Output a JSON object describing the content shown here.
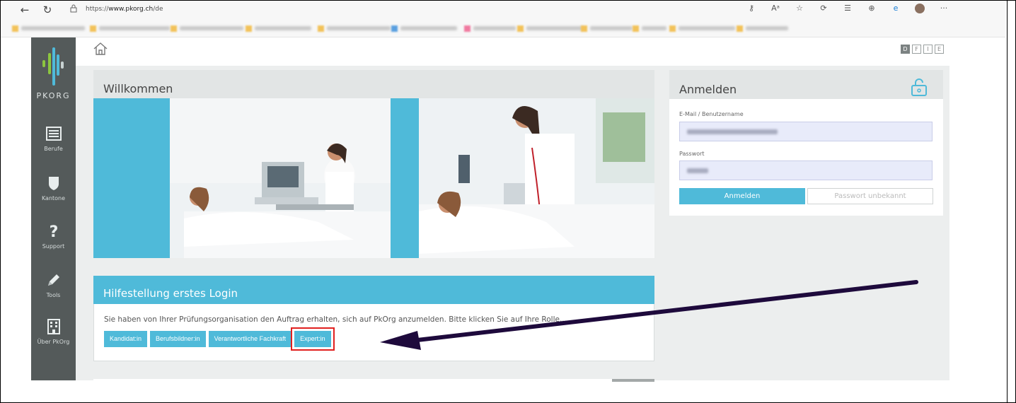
{
  "browser": {
    "url_prefix": "https://",
    "url_host": "www.pkorg.ch",
    "url_path": "/de"
  },
  "sidebar": {
    "logo_text": "PKORG",
    "items": [
      {
        "label": "Berufe",
        "icon": "list-icon"
      },
      {
        "label": "Kantone",
        "icon": "shield-icon"
      },
      {
        "label": "Support",
        "icon": "question-icon"
      },
      {
        "label": "Tools",
        "icon": "pencil-icon"
      },
      {
        "label": "Über PkOrg",
        "icon": "building-icon"
      }
    ]
  },
  "languages": [
    "D",
    "F",
    "I",
    "E"
  ],
  "welcome": {
    "title": "Willkommen"
  },
  "help": {
    "title": "Hilfestellung erstes Login",
    "text": "Sie haben von Ihrer Prüfungsorganisation den Auftrag erhalten, sich auf PkOrg anzumelden. Bitte klicken Sie auf Ihre Rolle...",
    "buttons": [
      "Kandidat:in",
      "Berufsbildner:in",
      "Verantwortliche Fachkraft",
      "Expert:in"
    ]
  },
  "login": {
    "title": "Anmelden",
    "username_label": "E-Mail / Benutzername",
    "password_label": "Passwort",
    "submit_label": "Anmelden",
    "forgot_label": "Passwort unbekannt"
  },
  "colors": {
    "accent": "#4fbad9",
    "sidebar": "#545a5a",
    "highlight": "#e0201f",
    "arrow": "#1e0a3c"
  }
}
